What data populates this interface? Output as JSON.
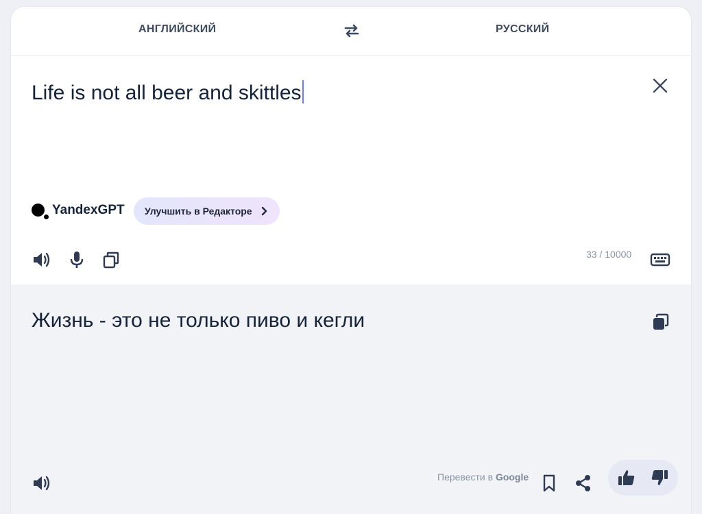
{
  "languages": {
    "source": "АНГЛИЙСКИЙ",
    "target": "РУССКИЙ",
    "swap_icon": "swap-arrows-icon"
  },
  "source": {
    "text": "Life is not all beer and skittles",
    "clear_icon": "close-icon",
    "gpt_brand": "YandexGPT",
    "improve_label": "Улучшить в Редакторе",
    "counter": "33 / 10000",
    "tools": [
      "speaker-icon",
      "microphone-icon",
      "copy-icon",
      "keyboard-icon"
    ]
  },
  "target": {
    "text": "Жизнь - это не только пиво и кегли",
    "google_prefix": "Перевести в ",
    "google_brand": "Google",
    "tools": [
      "speaker-icon",
      "copy-icon",
      "bookmark-icon",
      "share-icon",
      "thumbs-up-icon",
      "thumbs-down-icon"
    ]
  },
  "colors": {
    "text": "#14223a",
    "muted": "#8a93a3",
    "target_bg": "#f2f3f7",
    "caret": "#6b7bff"
  }
}
